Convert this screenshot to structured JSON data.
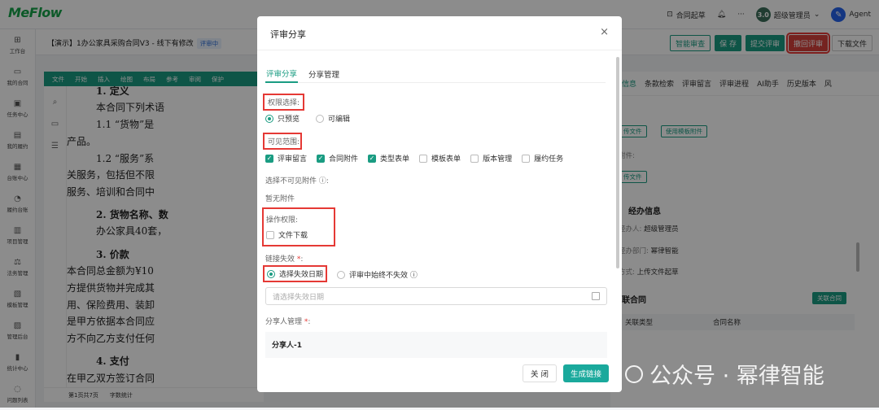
{
  "app": {
    "logo": "MeFlow"
  },
  "topbar": {
    "contract_draft": "合同起草",
    "more": "···",
    "avatar_text": "3.0",
    "username": "超级管理员",
    "agent_label": "Agent"
  },
  "sidebar": {
    "items": [
      {
        "label": "工作台",
        "icon": "grid-icon",
        "glyph": "⊞"
      },
      {
        "label": "我的合同",
        "icon": "folder-icon",
        "glyph": "▭"
      },
      {
        "label": "任务中心",
        "icon": "task-icon",
        "glyph": "▣"
      },
      {
        "label": "我的履约",
        "icon": "document-icon",
        "glyph": "▤"
      },
      {
        "label": "台账中心",
        "icon": "ledger-icon",
        "glyph": "▦"
      },
      {
        "label": "履约台账",
        "icon": "bell-icon",
        "glyph": "◔"
      },
      {
        "label": "项目管理",
        "icon": "project-icon",
        "glyph": "▥"
      },
      {
        "label": "法务管理",
        "icon": "legal-icon",
        "glyph": "⚖"
      },
      {
        "label": "模板管理",
        "icon": "template-icon",
        "glyph": "▧"
      },
      {
        "label": "管理后台",
        "icon": "admin-icon",
        "glyph": "▨"
      },
      {
        "label": "统计中心",
        "icon": "stats-icon",
        "glyph": "▮"
      },
      {
        "label": "问题列表",
        "icon": "question-icon",
        "glyph": "◌"
      }
    ]
  },
  "header": {
    "doc_title": "【演示】1办公家具采购合同V3 - 线下有修改",
    "status": "评审中",
    "buttons": {
      "smart_review": "智能审查",
      "save": "保 存",
      "submit_review": "提交评审",
      "withdraw_review": "撤回评审",
      "download": "下载文件"
    }
  },
  "editor": {
    "toolbar": [
      "文件",
      "开始",
      "插入",
      "绘图",
      "布局",
      "参考",
      "审阅",
      "保护"
    ],
    "lines": [
      "1. 定义",
      "本合同下列术语",
      "1.1 “货物”是",
      "产品。",
      "1.2 “服务”系",
      "关服务，包括但不限",
      "服务、培训和合同中",
      "2. 货物名称、数",
      "办公家具40套，",
      "3. 价款",
      "本合同总金额为¥10",
      "方提供货物并完成其",
      "用、保险费用、装卸",
      "是甲方依据本合同应",
      "方不向乙方支付任何",
      "4. 支付",
      "在甲乙双方签订合同"
    ],
    "footer_page": "第1页共7页",
    "footer_wordcount": "字数统计"
  },
  "right_panel": {
    "tabs": [
      "信息",
      "条款检索",
      "评审留言",
      "评审进程",
      "AI助手",
      "历史版本",
      "风"
    ],
    "upload_file": "传文件",
    "use_template_attachment": "使用模板附件",
    "attachment_label": "附件:",
    "upload_file_2": "传文件",
    "handler_title": "经办信息",
    "handler_person_label": "经办人:",
    "handler_person": "超级管理员",
    "handler_dept_label": "经办部门:",
    "handler_dept": "幂律智能",
    "method_label": "方式:",
    "method": "上传文件起草",
    "related_title": "联合同",
    "related_btn": "关联合同",
    "th_type": "关联类型",
    "th_name": "合同名称"
  },
  "modal": {
    "title": "评审分享",
    "tabs": [
      "评审分享",
      "分享管理"
    ],
    "permission_label": "权限选择:",
    "permission_options": [
      "只预览",
      "可编辑"
    ],
    "scope_label": "可见范围:",
    "scope_options": [
      {
        "label": "评审留言",
        "checked": true
      },
      {
        "label": "合同附件",
        "checked": true
      },
      {
        "label": "类型表单",
        "checked": true
      },
      {
        "label": "模板表单",
        "checked": false
      },
      {
        "label": "版本管理",
        "checked": false
      },
      {
        "label": "履约任务",
        "checked": false
      }
    ],
    "invisible_attachment_label": "选择不可见附件 ⓘ:",
    "no_attachment": "暂无附件",
    "operation_label": "操作权限:",
    "file_download": "文件下载",
    "expiry_label": "链接失效",
    "expiry_options": [
      "选择失效日期",
      "评审中始终不失效 ⓘ"
    ],
    "date_placeholder": "请选择失效日期",
    "sharer_mgmt_label": "分享人管理",
    "sharer_name": "分享人-1",
    "close_btn": "关 闭",
    "generate_btn": "生成链接"
  },
  "watermark": {
    "text": "公众号 · 幂律智能"
  },
  "colors": {
    "brand": "#1a9c82",
    "danger": "#d6403b",
    "highlight": "#e53935"
  }
}
